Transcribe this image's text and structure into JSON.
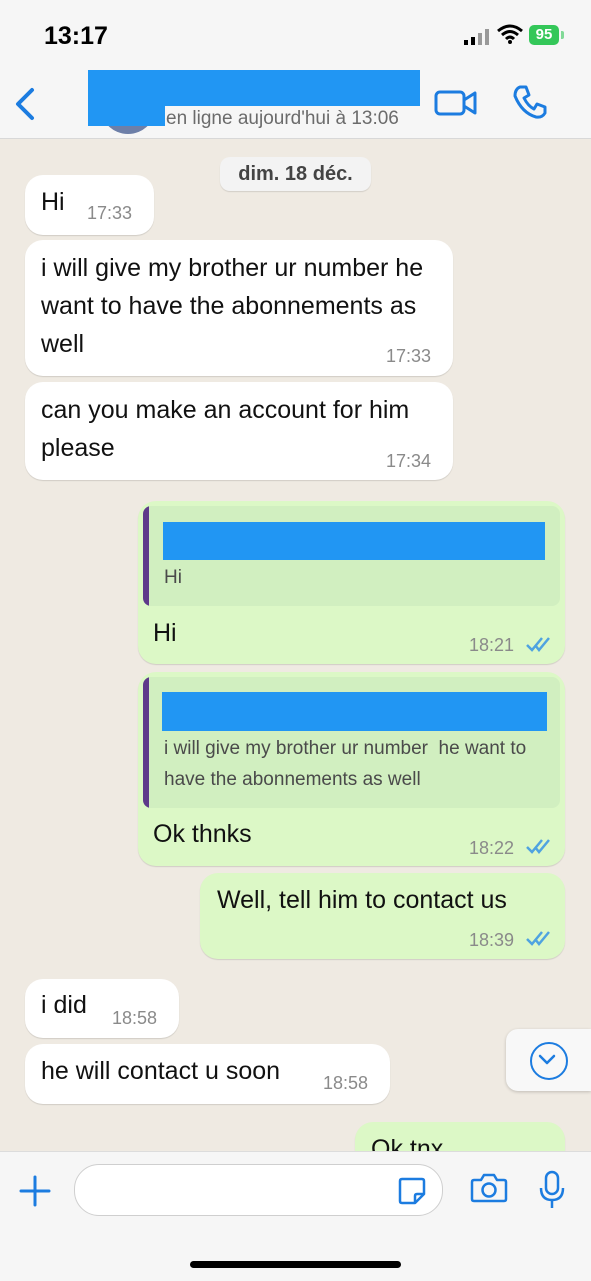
{
  "status_bar": {
    "time": "13:17",
    "battery": "95"
  },
  "header": {
    "presence": "en ligne aujourd'hui à 13:06"
  },
  "chat": {
    "date": "dim. 18 déc.",
    "messages": [
      {
        "dir": "in",
        "text": "Hi",
        "time": "17:33"
      },
      {
        "dir": "in",
        "text": "i will give my brother ur number he want to have the abonnements as well",
        "time": "17:33"
      },
      {
        "dir": "in",
        "text": "can you make an account for him please",
        "time": "17:34"
      },
      {
        "dir": "out",
        "quote": "Hi",
        "text": "Hi",
        "time": "18:21"
      },
      {
        "dir": "out",
        "quote": "i will give my brother ur number  he want to have the abonnements as well",
        "text": "Ok thnks",
        "time": "18:22"
      },
      {
        "dir": "out",
        "text": "Well, tell him to contact us",
        "time": "18:39"
      },
      {
        "dir": "in",
        "text": "i did",
        "time": "18:58"
      },
      {
        "dir": "in",
        "text": "he will contact u soon",
        "time": "18:58"
      },
      {
        "dir": "out",
        "text": "Ok tnx",
        "time": ""
      }
    ]
  },
  "colors": {
    "incoming": "#ffffff",
    "outgoing": "#dcf8c6",
    "accent": "#1c7ce0",
    "redaction": "#2196f3",
    "read_tick": "#4fa3e0"
  },
  "icons": [
    "back-icon",
    "video-call-icon",
    "phone-icon",
    "scroll-down-icon",
    "plus-icon",
    "sticker-icon",
    "camera-icon",
    "mic-icon"
  ]
}
